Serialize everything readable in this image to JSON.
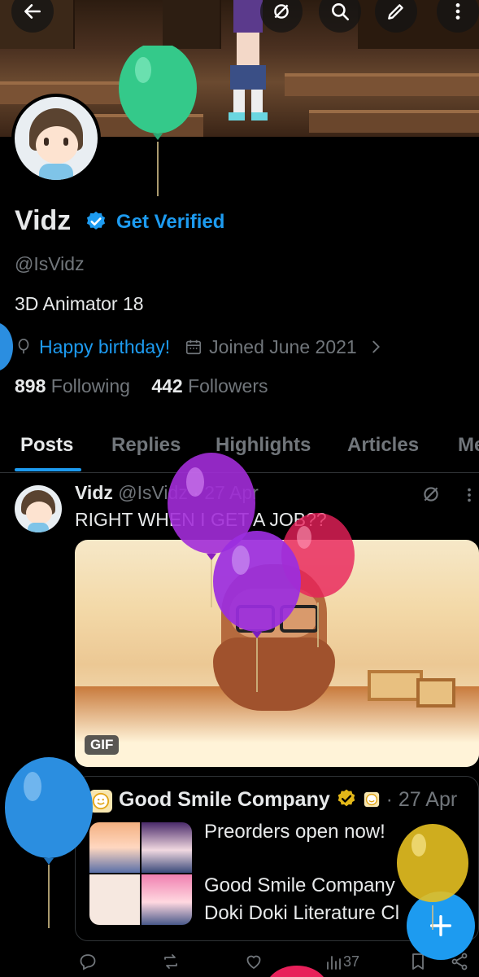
{
  "header": {
    "back_icon": "arrow-left-icon",
    "grok_icon": "grok-icon",
    "search_icon": "search-icon",
    "compose_icon": "compose-icon",
    "more_icon": "more-vertical-icon"
  },
  "profile": {
    "name": "Vidz",
    "get_verified": "Get Verified",
    "handle": "@IsVidz",
    "bio": "3D Animator  18",
    "birthday": "Happy birthday!",
    "joined": "Joined June 2021",
    "following_count": "898",
    "following_label": "Following",
    "followers_count": "442",
    "followers_label": "Followers"
  },
  "tabs": [
    "Posts",
    "Replies",
    "Highlights",
    "Articles",
    "Me"
  ],
  "post": {
    "author": "Vidz",
    "meta": "@IsVidz · 27 Apr",
    "text": "RIGHT WHEN I GET A JOB??",
    "gif_label": "GIF",
    "quoted": {
      "author": "Good Smile Company",
      "date": "· 27 Apr",
      "line1": "Preorders open now!",
      "line2": "Good Smile Company",
      "line3": "Doki Doki Literature Cl"
    },
    "actions": {
      "views": "37"
    }
  },
  "colors": {
    "accent": "#1d9bf0",
    "background": "#000000",
    "muted": "#71767b",
    "gold_badge": "#e2b719"
  }
}
